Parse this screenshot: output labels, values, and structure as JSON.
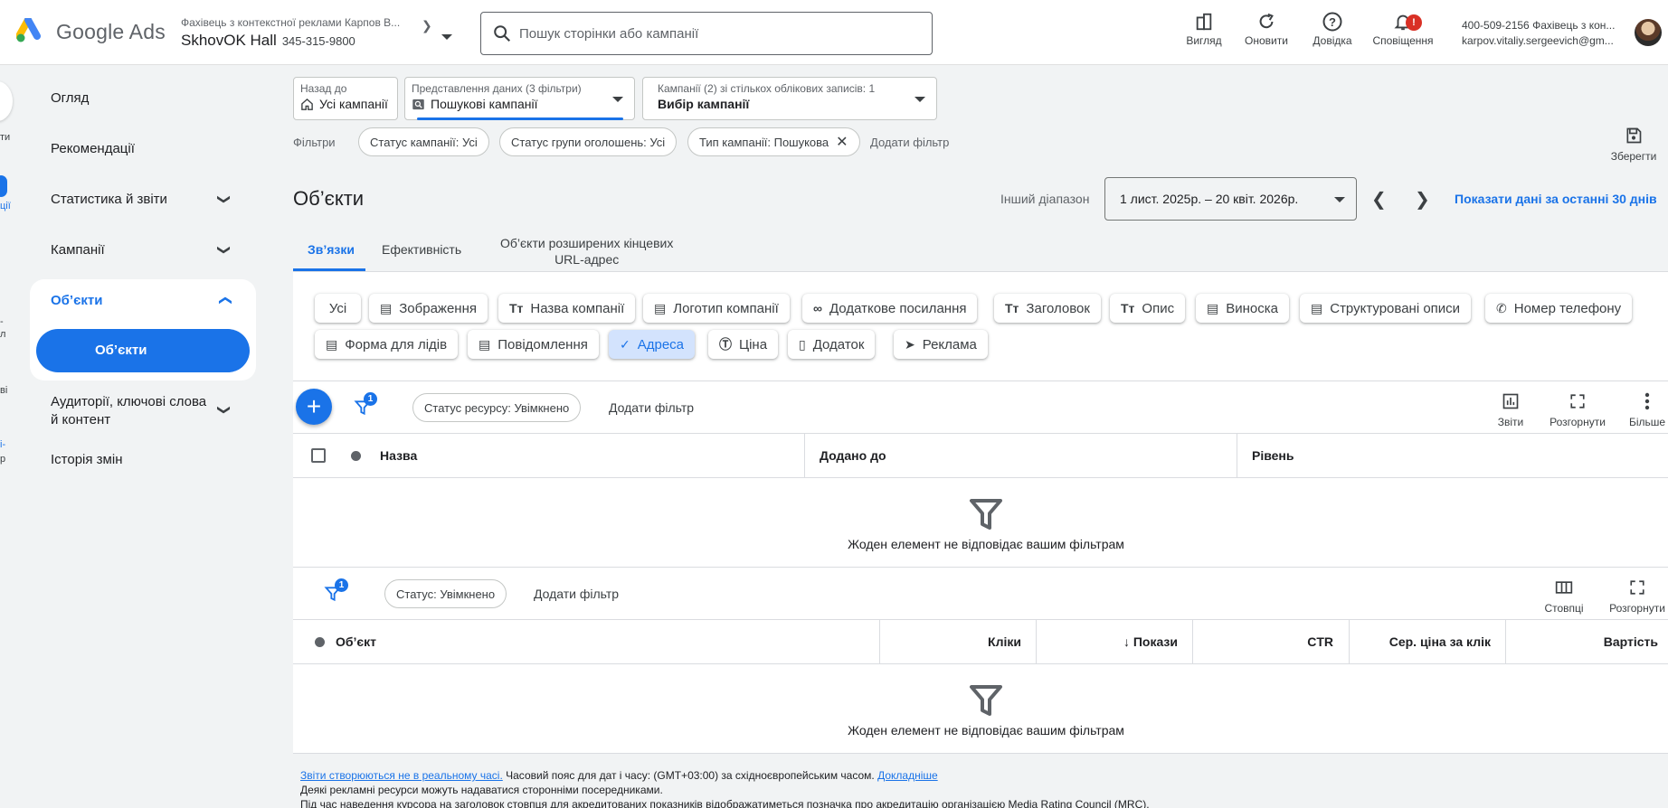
{
  "app": {
    "name": "Google Ads"
  },
  "account": {
    "description": "Фахівець з контекстної реклами Карпов В...",
    "name": "SkhovOK Hall",
    "id": "345-315-9800"
  },
  "search": {
    "placeholder": "Пошук сторінки або кампанії"
  },
  "toolbar": {
    "view": "Вигляд",
    "refresh": "Оновити",
    "help": "Довідка",
    "notifications": "Сповіщення",
    "notifications_badge": "!"
  },
  "user": {
    "line1": "400-509-2156 Фахівець з кон...",
    "line2": "karpov.vitaliy.sergeevich@gm..."
  },
  "rail": {
    "t1": "ти",
    "t2": "ції",
    "t3": "-",
    "t4": "л",
    "t5": "ві",
    "t6": "і-",
    "t7": "р"
  },
  "nav": {
    "overview": "Огляд",
    "recommendations": "Рекомендації",
    "stats": "Статистика й звіти",
    "campaigns": "Кампанії",
    "objects": "Об’єкти",
    "objects_sub": "Об’єкти",
    "audiences_l1": "Аудиторії, ключові слова",
    "audiences_l2": "й контент",
    "history": "Історія змін"
  },
  "selectors": {
    "back_label": "Назад до",
    "back_value": "Усі кампанії",
    "view_label": "Представлення даних (3 фільтри)",
    "view_value": "Пошукові кампанії",
    "campaigns_label": "Кампанії (2) зі стількох облікових записів: 1",
    "campaigns_value": "Вибір кампанії"
  },
  "filters": {
    "label": "Фільтри",
    "chips": [
      "Статус кампанії: Усі",
      "Статус групи оголошень: Усі",
      "Тип кампанії: Пошукова"
    ],
    "add": "Додати фільтр",
    "save": "Зберегти"
  },
  "page": {
    "title": "Об’єкти",
    "range_label": "Інший діапазон",
    "range_value": "1 лист. 2025р. – 20 квіт. 2026р.",
    "last30": "Показати дані за останні 30 днів"
  },
  "tabs": {
    "links": "Зв’язки",
    "performance": "Ефективність",
    "final_url_l1": "Об’єкти розширених кінцевих",
    "final_url_l2": "URL-адрес"
  },
  "asset_types": [
    "Усі",
    "Зображення",
    "Назва компанії",
    "Логотип компанії",
    "Додаткове посилання",
    "Заголовок",
    "Опис",
    "Виноска",
    "Структуровані описи",
    "Номер телефону",
    "Форма для лідів",
    "Повідомлення",
    "Адреса",
    "Ціна",
    "Додаток",
    "Реклама"
  ],
  "selected_asset_type": "Адреса",
  "table1": {
    "filter_badge": "1",
    "status_chip": "Статус ресурсу: Увімкнено",
    "add_filter": "Додати фільтр",
    "reports": "Звіти",
    "expand": "Розгорнути",
    "more": "Більше",
    "columns": [
      "Назва",
      "Додано до",
      "Рівень"
    ],
    "empty": "Жоден елемент не відповідає вашим фільтрам"
  },
  "table2": {
    "filter_badge": "1",
    "status_chip": "Статус: Увімкнено",
    "add_filter": "Додати фільтр",
    "columns_btn": "Стовпці",
    "expand": "Розгорнути",
    "columns": [
      "Об’єкт",
      "Кліки",
      "Покази",
      "CTR",
      "Сер. ціна за клік",
      "Вартість"
    ],
    "sort_arrow": "↓",
    "empty": "Жоден елемент не відповідає вашим фільтрам"
  },
  "footer": {
    "link1": "Звіти створюються не в реальному часі.",
    "tz": " Часовий пояс для дат і часу: (GMT+03:00) за східноєвропейським часом. ",
    "link2": "Докладніше",
    "line2": "Деякі рекламні ресурси можуть надаватися сторонніми посередниками.",
    "line3": "Під час наведення курсора на заголовок стовпця для акредитованих показників відображатиметься позначка про акредитацію організацією Media Rating Council (MRC)."
  },
  "colors": {
    "accent": "#1a73e8",
    "badge": "#d93025",
    "selected_chip": "#d3e3fd"
  }
}
